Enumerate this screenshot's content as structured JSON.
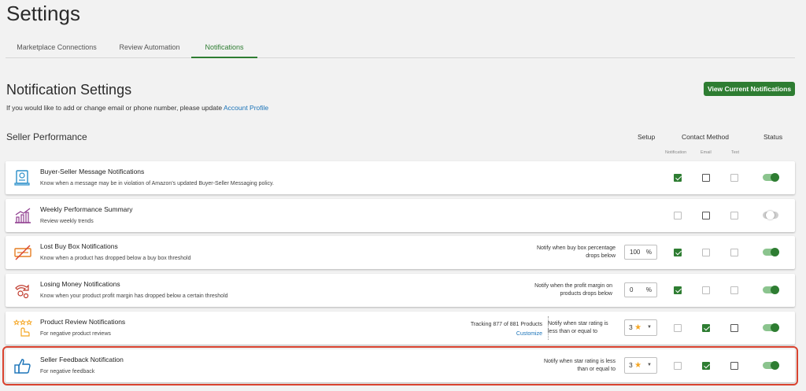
{
  "page": {
    "title": "Settings"
  },
  "tabs": [
    {
      "label": "Marketplace Connections"
    },
    {
      "label": "Review Automation"
    },
    {
      "label": "Notifications"
    }
  ],
  "notification_settings": {
    "title": "Notification Settings",
    "help_prefix": "If you would like to add or change email or phone number, please update ",
    "help_link": "Account Profile",
    "view_button": "View Current Notifications"
  },
  "seller_performance": {
    "title": "Seller Performance",
    "columns": {
      "setup": "Setup",
      "contact_method": "Contact Method",
      "status": "Status",
      "notification": "Notification",
      "email": "Email",
      "text": "Text"
    },
    "rows": [
      {
        "title": "Buyer-Seller Message Notifications",
        "desc": "Know when a message may be in violation of Amazon's updated Buyer-Seller Messaging policy.",
        "notification": true,
        "email": false,
        "text": false,
        "status": "on"
      },
      {
        "title": "Weekly Performance Summary",
        "desc": "Review weekly trends",
        "notification": false,
        "email": false,
        "text": false,
        "status": "off"
      },
      {
        "title": "Lost Buy Box Notifications",
        "desc": "Know when a product has dropped below a buy box threshold",
        "setup_text": "Notify when buy box percentage drops below",
        "setup_value": "100",
        "setup_unit": "%",
        "notification": true,
        "email": false,
        "text": false,
        "status": "on"
      },
      {
        "title": "Losing Money Notifications",
        "desc": "Know when your product profit margin has dropped below a certain threshold",
        "setup_text": "Notify when the profit margin on products drops below",
        "setup_value": "0",
        "setup_unit": "%",
        "notification": true,
        "email": false,
        "text": false,
        "status": "on"
      },
      {
        "title": "Product Review Notifications",
        "desc": "For negative product reviews",
        "tracking": "Tracking 877 of 881 Products",
        "customize": "Customize",
        "setup_text": "Notify when star rating is less than or equal to",
        "setup_value": "3",
        "notification": false,
        "email": true,
        "text": false,
        "status": "on"
      },
      {
        "title": "Seller Feedback Notification",
        "desc": "For negative feedback",
        "setup_text": "Notify when star rating is less than or equal to",
        "setup_value": "3",
        "notification": false,
        "email": true,
        "text": false,
        "status": "on"
      }
    ]
  },
  "colors": {
    "accent": "#2e7d32",
    "link": "#1a73b8",
    "highlight": "#d9432f",
    "star": "#f5a623"
  }
}
